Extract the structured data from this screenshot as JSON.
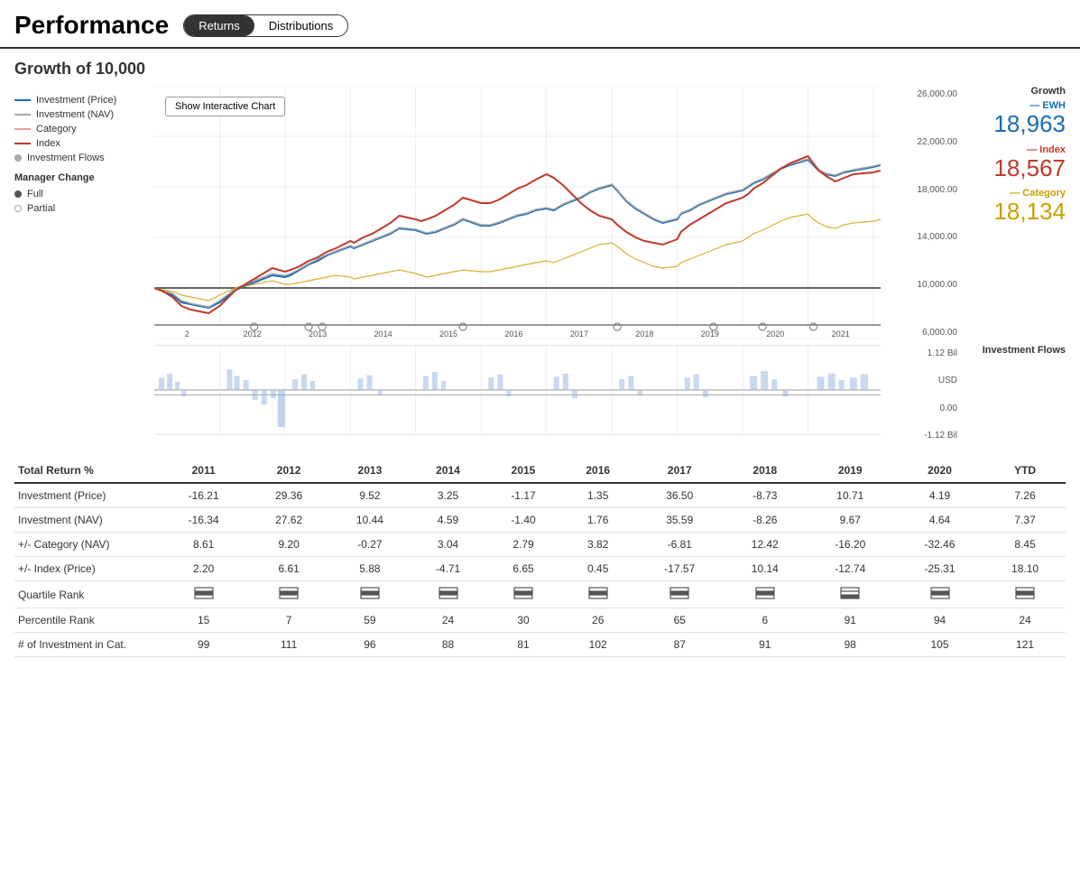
{
  "header": {
    "title": "Performance",
    "tabs": [
      {
        "label": "Returns",
        "active": true
      },
      {
        "label": "Distributions",
        "active": false
      }
    ]
  },
  "growth_section": {
    "title": "Growth of 10,000",
    "show_chart_btn": "Show Interactive Chart"
  },
  "legend": {
    "items": [
      {
        "label": "Investment (Price)",
        "color": "#1a6bb5",
        "type": "line-solid"
      },
      {
        "label": "Investment (NAV)",
        "color": "#aaa",
        "type": "line-solid"
      },
      {
        "label": "Category",
        "color": "#e8a0a0",
        "type": "line-solid"
      },
      {
        "label": "Index",
        "color": "#c0392b",
        "type": "line-solid"
      },
      {
        "label": "Investment Flows",
        "color": "#aaa",
        "type": "dot"
      }
    ],
    "manager_change": "Manager Change",
    "full": "Full",
    "partial": "Partial"
  },
  "right_panel": {
    "growth_label": "Growth",
    "ewh_label": "— EWH",
    "ewh_value": "18,963",
    "index_label": "— Index",
    "index_value": "18,567",
    "category_label": "— Category",
    "category_value": "18,134"
  },
  "main_axis": {
    "values": [
      "26,000.00",
      "22,000.00",
      "18,000.00",
      "14,000.00",
      "10,000.00",
      "6,000.00"
    ]
  },
  "flow_section": {
    "label": "Investment Flows",
    "top": "1.12 Bil",
    "unit": "USD",
    "zero": "0.00",
    "bottom": "-1.12 Bil"
  },
  "table": {
    "title": "Total Return %",
    "years": [
      "2011",
      "2012",
      "2013",
      "2014",
      "2015",
      "2016",
      "2017",
      "2018",
      "2019",
      "2020",
      "YTD"
    ],
    "rows": [
      {
        "label": "Investment (Price)",
        "values": [
          "-16.21",
          "29.36",
          "9.52",
          "3.25",
          "-1.17",
          "1.35",
          "36.50",
          "-8.73",
          "10.71",
          "4.19",
          "7.26"
        ]
      },
      {
        "label": "Investment (NAV)",
        "values": [
          "-16.34",
          "27.62",
          "10.44",
          "4.59",
          "-1.40",
          "1.76",
          "35.59",
          "-8.26",
          "9.67",
          "4.64",
          "7.37"
        ]
      },
      {
        "label": "+/- Category (NAV)",
        "values": [
          "8.61",
          "9.20",
          "-0.27",
          "3.04",
          "2.79",
          "3.82",
          "-6.81",
          "12.42",
          "-16.20",
          "-32.46",
          "8.45"
        ]
      },
      {
        "label": "+/- Index (Price)",
        "values": [
          "2.20",
          "6.61",
          "5.88",
          "-4.71",
          "6.65",
          "0.45",
          "-17.57",
          "10.14",
          "-12.74",
          "-25.31",
          "18.10"
        ]
      }
    ],
    "quartile_row_label": "Quartile Rank",
    "quartile_values": [
      "q2",
      "q2",
      "q2",
      "q2",
      "q2",
      "q2",
      "q2",
      "q2",
      "q3",
      "q2",
      "q2"
    ],
    "percentile_label": "Percentile Rank",
    "percentile_values": [
      "15",
      "7",
      "59",
      "24",
      "30",
      "26",
      "65",
      "6",
      "91",
      "94",
      "24"
    ],
    "investment_cat_label": "# of Investment in Cat.",
    "investment_cat_values": [
      "99",
      "111",
      "96",
      "88",
      "81",
      "102",
      "87",
      "91",
      "98",
      "105",
      "121"
    ]
  }
}
